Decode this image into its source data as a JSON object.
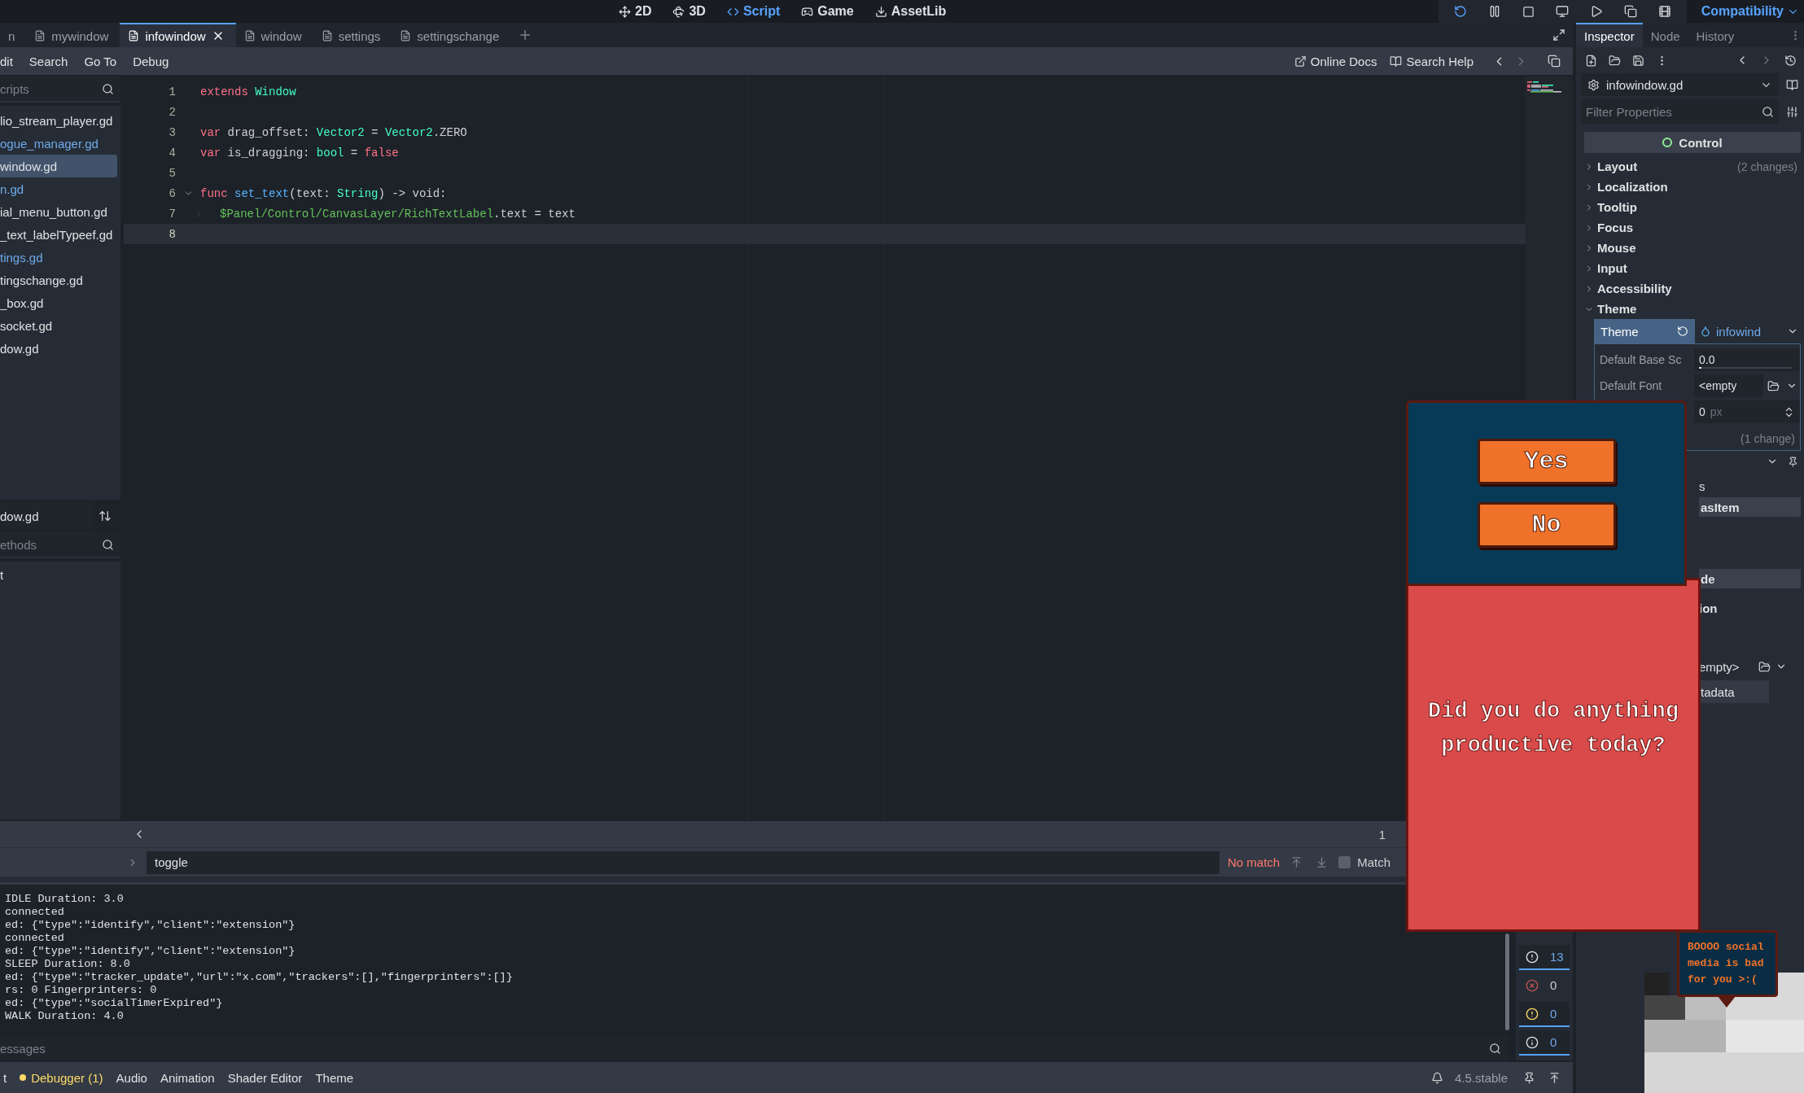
{
  "main_toolbar": {
    "workspaces": [
      {
        "label": "2D",
        "selected": false
      },
      {
        "label": "3D",
        "selected": false
      },
      {
        "label": "Script",
        "selected": true
      },
      {
        "label": "Game",
        "selected": false
      },
      {
        "label": "AssetLib",
        "selected": false
      }
    ],
    "renderer": "Compatibility"
  },
  "script_tabs": [
    {
      "label": "n",
      "selected": false
    },
    {
      "label": "mywindow",
      "selected": false
    },
    {
      "label": "infowindow",
      "selected": true
    },
    {
      "label": "window",
      "selected": false
    },
    {
      "label": "settings",
      "selected": false
    },
    {
      "label": "settingschange",
      "selected": false
    }
  ],
  "script_menu": [
    "dit",
    "Search",
    "Go To",
    "Debug"
  ],
  "help_links": [
    "Online Docs",
    "Search Help"
  ],
  "scripts_panel": {
    "filter_placeholder": "cripts",
    "files": [
      {
        "name": "lio_stream_player.gd",
        "selected": false,
        "accent": false
      },
      {
        "name": "ogue_manager.gd",
        "selected": false,
        "accent": true
      },
      {
        "name": "window.gd",
        "selected": true,
        "accent": false
      },
      {
        "name": "n.gd",
        "selected": false,
        "accent": true
      },
      {
        "name": "ial_menu_button.gd",
        "selected": false,
        "accent": false
      },
      {
        "name": "_text_labelTypeef.gd",
        "selected": false,
        "accent": false
      },
      {
        "name": "tings.gd",
        "selected": false,
        "accent": true
      },
      {
        "name": "tingschange.gd",
        "selected": false,
        "accent": false
      },
      {
        "name": "_box.gd",
        "selected": false,
        "accent": false
      },
      {
        "name": "socket.gd",
        "selected": false,
        "accent": false
      },
      {
        "name": "dow.gd",
        "selected": false,
        "accent": false
      }
    ],
    "current_script": "dow.gd",
    "methods_placeholder": "ethods",
    "methods": [
      "t"
    ]
  },
  "code": [
    {
      "number": "1",
      "current": false,
      "fold": false,
      "indent": false,
      "tokens": [
        {
          "kind": "keyword",
          "text": "extends"
        },
        {
          "kind": "type",
          "text": " Window"
        }
      ]
    },
    {
      "number": "2",
      "current": false,
      "fold": false,
      "indent": false
    },
    {
      "number": "3",
      "current": false,
      "fold": false,
      "indent": false,
      "tokens": [
        {
          "kind": "keyword",
          "text": "var"
        },
        {
          "kind": "text",
          "text": " drag_offset: "
        },
        {
          "kind": "type",
          "text": "Vector2"
        },
        {
          "kind": "text",
          "text": " = "
        },
        {
          "kind": "type",
          "text": "Vector2"
        },
        {
          "kind": "text",
          "text": ".ZERO"
        }
      ]
    },
    {
      "number": "4",
      "current": false,
      "fold": false,
      "indent": false,
      "tokens": [
        {
          "kind": "keyword",
          "text": "var"
        },
        {
          "kind": "text",
          "text": " is_dragging: "
        },
        {
          "kind": "type",
          "text": "bool"
        },
        {
          "kind": "text",
          "text": " = "
        },
        {
          "kind": "keyword",
          "text": "false"
        }
      ]
    },
    {
      "number": "5",
      "current": false,
      "fold": false,
      "indent": false
    },
    {
      "number": "6",
      "current": false,
      "fold": true,
      "indent": false,
      "tokens": [
        {
          "kind": "keyword",
          "text": "func"
        },
        {
          "kind": "function",
          "text": " set_text"
        },
        {
          "kind": "text",
          "text": "(text: "
        },
        {
          "kind": "type",
          "text": "String"
        },
        {
          "kind": "text",
          "text": ") -> void:"
        }
      ]
    },
    {
      "number": "7",
      "current": false,
      "fold": false,
      "indent": true,
      "tokens": [
        {
          "kind": "nodepath",
          "text": "$Panel/Control/CanvasLayer/RichTextLabel"
        },
        {
          "kind": "text",
          "text": ".text = text"
        }
      ]
    },
    {
      "number": "8",
      "current": true,
      "fold": false,
      "indent": false
    }
  ],
  "editor_status": "1",
  "find_bar": {
    "query": "toggle",
    "status": "No match",
    "match_case": {
      "label": "Match",
      "checked": false
    }
  },
  "output": [
    "IDLE Duration: 3.0",
    "connected",
    "ed: {\"type\":\"identify\",\"client\":\"extension\"}",
    "connected",
    "ed: {\"type\":\"identify\",\"client\":\"extension\"}",
    "SLEEP Duration: 8.0",
    "ed: {\"type\":\"tracker_update\",\"url\":\"x.com\",\"trackers\":[],\"fingerprinters\":[]}",
    "rs: 0 Fingerprinters: 0",
    "ed: {\"type\":\"socialTimerExpired\"}",
    "WALK Duration: 4.0"
  ],
  "output_filter_placeholder": "essages",
  "message_toggles": [
    {
      "kind": "message",
      "count": "13",
      "on": true
    },
    {
      "kind": "error",
      "count": "0",
      "on": false
    },
    {
      "kind": "warning",
      "count": "0",
      "on": true
    },
    {
      "kind": "info",
      "count": "0",
      "on": true
    }
  ],
  "bottom_tabs": [
    {
      "label": "t",
      "alert": false
    },
    {
      "label": "Debugger (1)",
      "alert": true
    },
    {
      "label": "Audio",
      "alert": false
    },
    {
      "label": "Animation",
      "alert": false
    },
    {
      "label": "Shader Editor",
      "alert": false
    },
    {
      "label": "Theme",
      "alert": false
    }
  ],
  "version": "4.5.stable",
  "inspector": {
    "tabs": [
      {
        "label": "Inspector",
        "selected": true
      },
      {
        "label": "Node",
        "selected": false
      },
      {
        "label": "History",
        "selected": false
      }
    ],
    "resource": "infowindow.gd",
    "filter_placeholder": "Filter Properties",
    "class_name": "Control",
    "sections": [
      {
        "label": "Layout",
        "expanded": false,
        "note": "(2 changes)"
      },
      {
        "label": "Localization",
        "expanded": false
      },
      {
        "label": "Tooltip",
        "expanded": false
      },
      {
        "label": "Focus",
        "expanded": false
      },
      {
        "label": "Mouse",
        "expanded": false
      },
      {
        "label": "Input",
        "expanded": false
      },
      {
        "label": "Accessibility",
        "expanded": false
      },
      {
        "label": "Theme",
        "expanded": true
      }
    ],
    "theme": {
      "label": "Theme",
      "value": "infowind",
      "properties": [
        {
          "kind": "slider",
          "label": "Default Base Sc",
          "value": "0.0",
          "level": 0.02
        },
        {
          "kind": "resource",
          "label": "Default Font",
          "value": "<empty"
        },
        {
          "kind": "spin",
          "value": "0",
          "unit": "px"
        }
      ],
      "note": "(1 change)"
    },
    "fragments": [
      {
        "kind": "plain",
        "text": "s"
      },
      {
        "kind": "header",
        "text": "asItem"
      },
      {
        "kind": "header",
        "text": "de"
      },
      {
        "kind": "bold",
        "text": "ion"
      },
      {
        "kind": "resource",
        "text": "empty>"
      },
      {
        "kind": "button",
        "text": "tadata"
      }
    ]
  },
  "popup": {
    "buttons": [
      "Yes",
      "No"
    ],
    "question": "Did you do anything productive today?"
  },
  "speech_bubble": "BOOOO social media is bad for you >:("
}
